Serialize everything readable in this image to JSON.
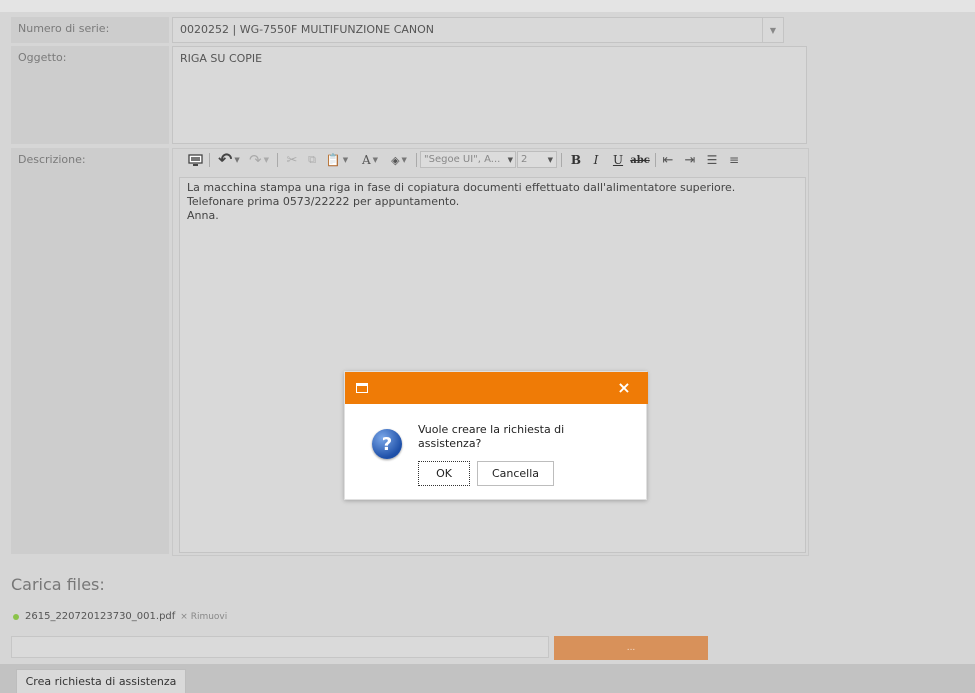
{
  "form": {
    "serial_label": "Numero di serie:",
    "serial_value": "0020252 | WG-7550F MULTIFUNZIONE CANON",
    "subject_label": "Oggetto:",
    "subject_value": "RIGA SU COPIE",
    "description_label": "Descrizione:",
    "description_lines": [
      "La macchina stampa una riga in fase di copiatura documenti effettuato dall'alimentatore superiore.",
      "Telefonare prima 0573/22222 per appuntamento.",
      "Anna."
    ]
  },
  "editor_toolbar": {
    "font_family": "\"Segoe UI\", A...",
    "font_size": "2",
    "icons": [
      "monitor-icon",
      "undo-icon",
      "redo-icon",
      "cut-icon",
      "copy-icon",
      "paste-icon",
      "font-color-icon",
      "highlight-icon",
      "bold-icon",
      "italic-icon",
      "underline-icon",
      "strikethrough-icon",
      "outdent-icon",
      "indent-icon",
      "ordered-list-icon",
      "unordered-list-icon"
    ]
  },
  "upload": {
    "title": "Carica files:",
    "file_name": "2615_220720123730_001.pdf",
    "remove_label": "Rimuovi",
    "browse_label": "..."
  },
  "footer": {
    "create_button": "Crea richiesta di assistenza"
  },
  "dialog": {
    "message": "Vuole creare la richiesta di assistenza?",
    "ok_label": "OK",
    "cancel_label": "Cancella",
    "close_glyph": "×"
  },
  "colors": {
    "accent_orange": "#ef7b06",
    "browse_button": "#d8915a",
    "file_dot": "#8bc34a"
  }
}
